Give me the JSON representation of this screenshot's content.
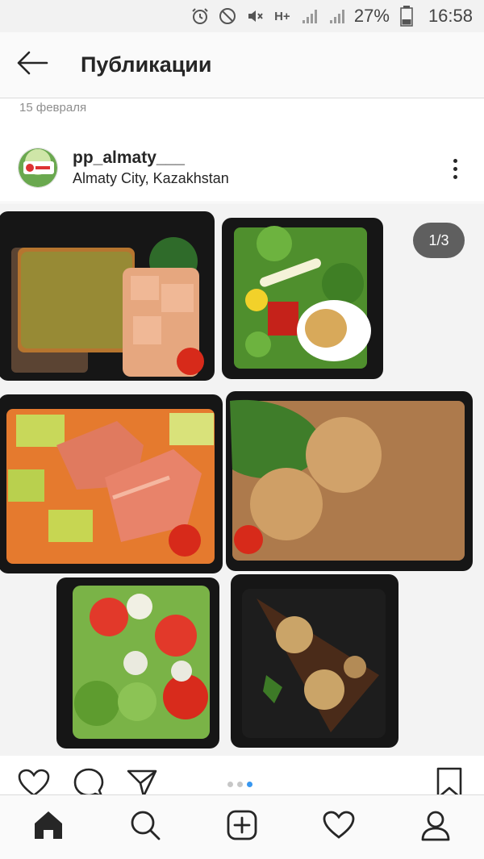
{
  "status_bar": {
    "network": "H+",
    "battery_percent": "27%",
    "time": "16:58",
    "icons": [
      "alarm-icon",
      "do-not-disturb-icon",
      "mute-icon",
      "signal-icon",
      "signal-icon",
      "battery-icon"
    ]
  },
  "header": {
    "title": "Публикации",
    "back_icon": "arrow-left-icon"
  },
  "post": {
    "date": "15 февраля",
    "username": "pp_almaty___",
    "location": "Almaty City, Kazakhstan",
    "carousel_counter": "1/3",
    "carousel_total": 3,
    "carousel_current": 1,
    "more_icon": "more-vertical-icon"
  },
  "actions": {
    "icons": [
      "heart-icon",
      "comment-icon",
      "send-icon",
      "bookmark-icon"
    ]
  },
  "bottom_nav": {
    "items": [
      {
        "name": "home",
        "icon": "home-icon",
        "active": true
      },
      {
        "name": "search",
        "icon": "search-icon",
        "active": false
      },
      {
        "name": "new-post",
        "icon": "add-post-icon",
        "active": false
      },
      {
        "name": "activity",
        "icon": "heart-icon",
        "active": false
      },
      {
        "name": "profile",
        "icon": "profile-icon",
        "active": false
      }
    ]
  },
  "colors": {
    "accent": "#3897f0",
    "text": "#262626",
    "muted": "#8e8e8e"
  }
}
